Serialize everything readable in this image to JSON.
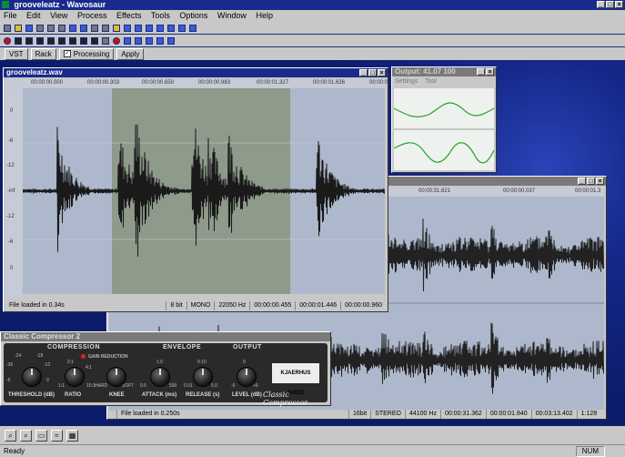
{
  "app": {
    "title": "grooveleatz - Wavosaur"
  },
  "menu": [
    "File",
    "Edit",
    "View",
    "Process",
    "Effects",
    "Tools",
    "Options",
    "Window",
    "Help"
  ],
  "tabs": [
    {
      "label": "VST"
    },
    {
      "label": "Rack"
    },
    {
      "label": "Processing",
      "checked": true
    },
    {
      "label": "Apply"
    }
  ],
  "main_window": {
    "title": "grooveleatz.wav",
    "ruler": [
      "00:00:00.000",
      "00:00:00.303",
      "00:00:00.650",
      "00:00:00.983",
      "00:00:01.327",
      "00:00:01.636",
      "00:00:02"
    ],
    "db_labels": [
      "0",
      "-6",
      "-12",
      "-inf",
      "-12",
      "-6",
      "0"
    ],
    "status": [
      "File loaded in 0.34s",
      "8 bit",
      "MONO",
      "22050 Hz",
      "00:00:00.455",
      "00:00:01.446",
      "00:00:00.960"
    ]
  },
  "output_window": {
    "title": "Output: 41.07 100",
    "menu": [
      "Settings",
      "Tool"
    ]
  },
  "second_window": {
    "ruler": [
      "00:00:31.621",
      "00:00:00.037",
      "00:00:01.3"
    ],
    "status": [
      "File loaded in 0.250s",
      "16bit",
      "STEREO",
      "44100 Hz",
      "00:00:31.362",
      "00:00:01.840",
      "00:03:13.402",
      "1:128"
    ]
  },
  "compressor": {
    "title": "Classic Compressor 2",
    "sections": [
      "COMPRESSION",
      "ENVELOPE",
      "OUTPUT"
    ],
    "gain_reduction": "GAIN REDUCTION",
    "knobs": [
      {
        "label": "THRESHOLD (dB)",
        "ticks": [
          "-24",
          "-36",
          "-18",
          "-12",
          "-6",
          "0"
        ]
      },
      {
        "label": "RATIO",
        "ticks": [
          "2:1",
          "1:1",
          "4:1",
          "10:1"
        ]
      },
      {
        "label": "KNEE",
        "ticks": [
          "HARD",
          "SOFT"
        ]
      },
      {
        "label": "ATTACK (ms)",
        "ticks": [
          "1.0",
          "0.5",
          "500"
        ]
      },
      {
        "label": "RELEASE (s)",
        "ticks": [
          "0.10",
          "0.01",
          "5.0"
        ]
      },
      {
        "label": "LEVEL (dB)",
        "ticks": [
          "0",
          "+6",
          "-6"
        ]
      }
    ],
    "logo": "KJAERHUS AUDIO",
    "brand": "Classic Compressor"
  },
  "statusbar": {
    "left": "Ready",
    "right": "NUM"
  },
  "colors": {
    "title": "#1a2a8c",
    "chrome": "#c8c8c8",
    "wave": "#aeb8cc",
    "wave_line": "#222222",
    "selection": "#8e9a8a",
    "output": "#2aa02a"
  }
}
